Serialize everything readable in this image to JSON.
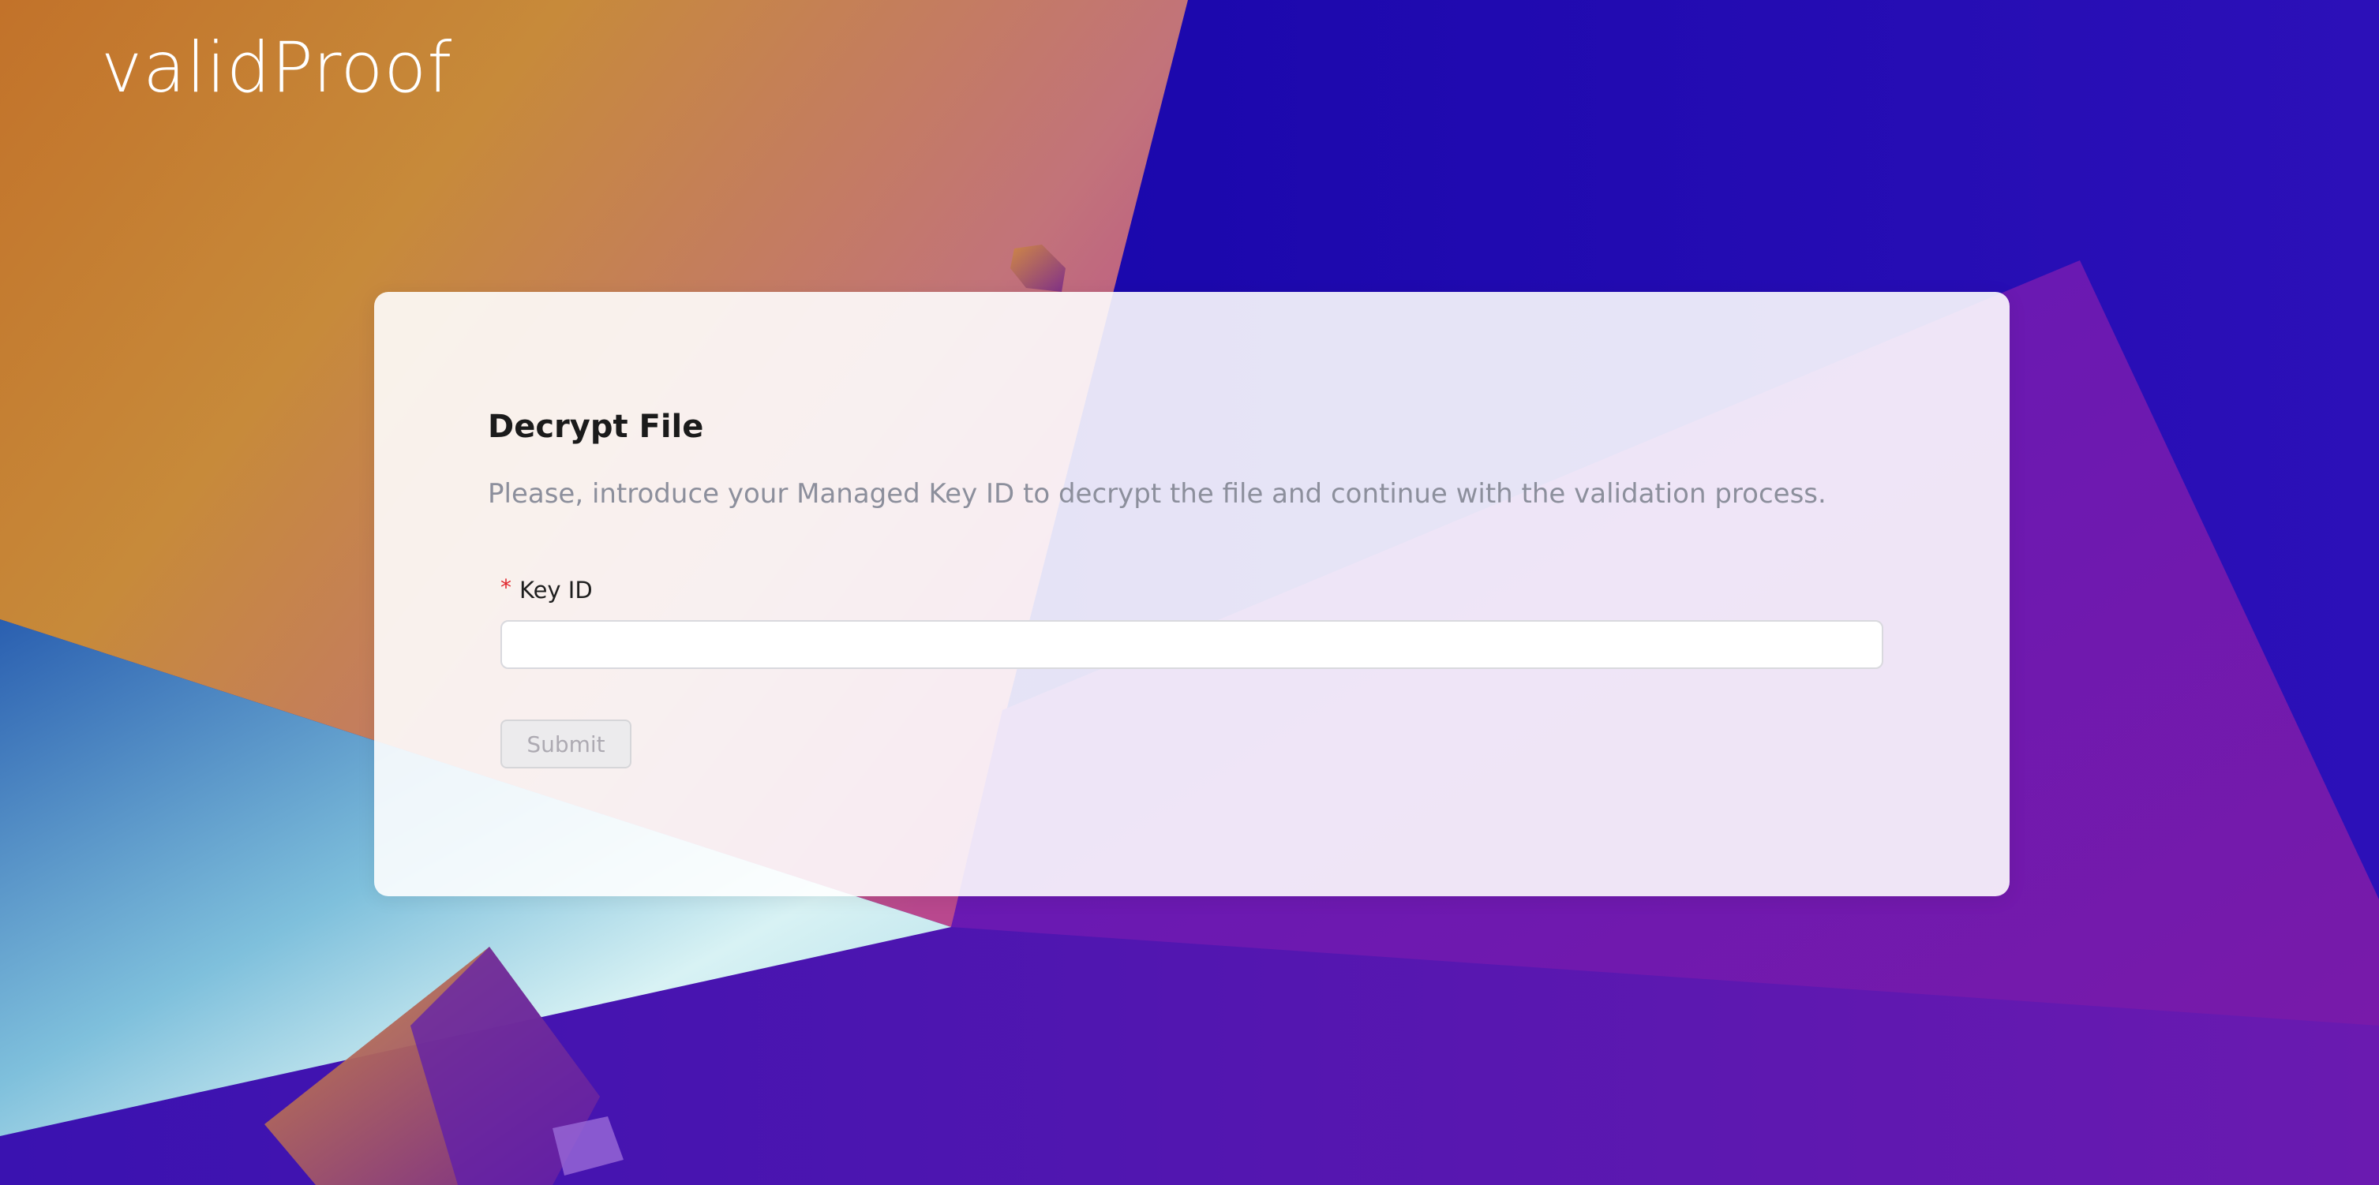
{
  "brand": {
    "logo_text": "validProof"
  },
  "decrypt_form": {
    "title": "Decrypt File",
    "description": "Please, introduce your Managed Key ID to decrypt the file and continue with the validation process.",
    "key_field": {
      "required_marker": "*",
      "label": "Key ID",
      "value": "",
      "placeholder": ""
    },
    "submit_label": "Submit",
    "submit_disabled": true
  },
  "colors": {
    "required": "#e0282e",
    "title": "#1b1b1b",
    "description": "#8c8f9c",
    "background_primary": "#1a06a8",
    "background_warm": "#c9832e",
    "background_purple": "#6d18b0"
  },
  "icons": []
}
